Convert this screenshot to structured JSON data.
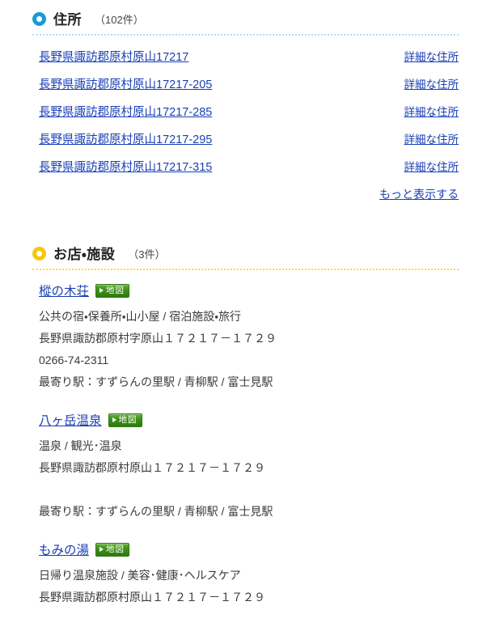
{
  "address_section": {
    "icon": "blue-ring-icon",
    "title": "住所",
    "count_label": "（102件）",
    "accent_color": "#1b9ad6",
    "divider_color": "#b9dcee",
    "detail_link_label": "詳細な住所",
    "more_label": "もっと表示する",
    "items": [
      {
        "address": "長野県諏訪郡原村原山17217",
        "detail": "詳細な住所"
      },
      {
        "address": "長野県諏訪郡原村原山17217-205",
        "detail": "詳細な住所"
      },
      {
        "address": "長野県諏訪郡原村原山17217-285",
        "detail": "詳細な住所"
      },
      {
        "address": "長野県諏訪郡原村原山17217-295",
        "detail": "詳細な住所"
      },
      {
        "address": "長野県諏訪郡原村原山17217-315",
        "detail": "詳細な住所"
      }
    ]
  },
  "facility_section": {
    "icon": "gold-ring-icon",
    "title": "お店・施設",
    "count_label": "（3件）",
    "accent_color": "#f6c709",
    "divider_color": "#f5d95a",
    "map_button_label": "地図",
    "map_button_icon": "play-triangle-icon",
    "items": [
      {
        "name": "樅の木荘",
        "map_label": "地図",
        "category": "公共の宿・保養所・山小屋 / 宿泊施設・旅行",
        "address": "長野県諏訪郡原村字原山１７２１７－１７２９",
        "phone": "0266-74-2311",
        "stations": "最寄り駅：すずらんの里駅 / 青柳駅 / 富士見駅"
      },
      {
        "name": "八ヶ岳温泉",
        "map_label": "地図",
        "category": "温泉 / 観光･温泉",
        "address": "長野県諏訪郡原村原山１７２１７－１７２９",
        "phone": "",
        "stations": "最寄り駅：すずらんの里駅 / 青柳駅 / 富士見駅"
      },
      {
        "name": "もみの湯",
        "map_label": "地図",
        "category": "日帰り温泉施設 / 美容･健康･ヘルスケア",
        "address": "長野県諏訪郡原村原山１７２１７－１７２９",
        "phone": "",
        "stations": ""
      }
    ]
  }
}
